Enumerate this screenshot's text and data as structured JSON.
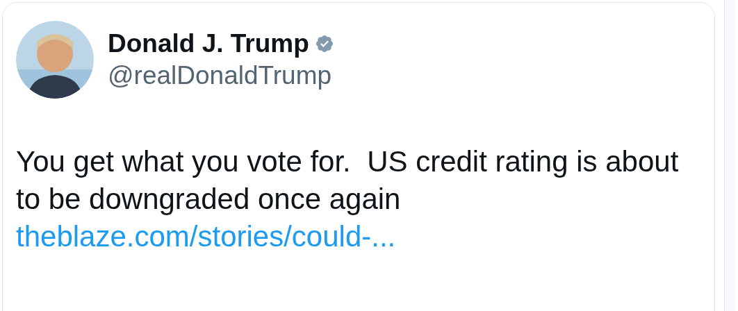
{
  "tweet": {
    "author": {
      "name": "Donald J. Trump",
      "verified": true,
      "handle": "@realDonaldTrump"
    },
    "text": "You get what you vote for.  US credit rating is about to be downgraded once again",
    "link": "theblaze.com/stories/could-..."
  }
}
